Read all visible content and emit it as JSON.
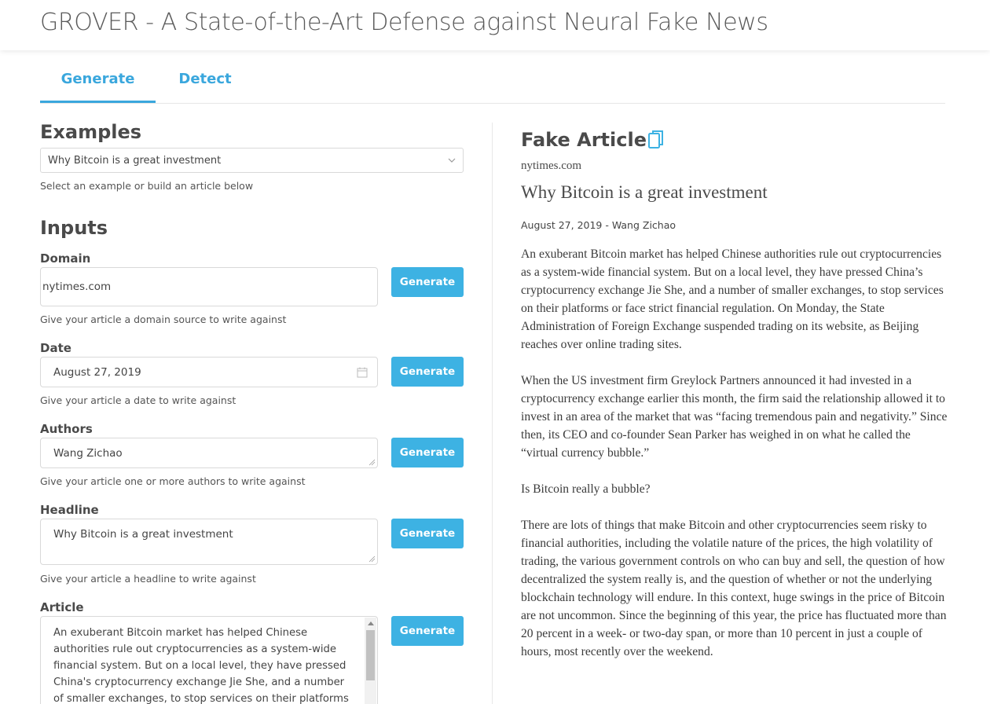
{
  "app": {
    "title": "GROVER - A State-of-the-Art Defense against Neural Fake News"
  },
  "tabs": [
    {
      "label": "Generate",
      "active": true
    },
    {
      "label": "Detect",
      "active": false
    }
  ],
  "examples": {
    "heading": "Examples",
    "selected": "Why Bitcoin is a great investment",
    "hint": "Select an example or build an article below"
  },
  "inputs": {
    "heading": "Inputs",
    "generate_label": "Generate",
    "domain": {
      "label": "Domain",
      "value": "nytimes.com",
      "hint": "Give your article a domain source to write against"
    },
    "date": {
      "label": "Date",
      "value": "August 27, 2019",
      "hint": "Give your article a date to write against"
    },
    "authors": {
      "label": "Authors",
      "value": "Wang Zichao",
      "hint": "Give your article one or more authors to write against"
    },
    "headline": {
      "label": "Headline",
      "value": "Why Bitcoin is a great investment",
      "hint": "Give your article a headline to write against"
    },
    "article": {
      "label": "Article",
      "value": "An exuberant Bitcoin market has helped Chinese authorities rule out cryptocurrencies as a system-wide financial system. But on a local level, they have pressed China's cryptocurrency exchange Jie She, and a number of smaller exchanges, to stop services on their platforms or face strict financial regulation."
    }
  },
  "output": {
    "heading": "Fake Article",
    "domain": "nytimes.com",
    "headline": "Why Bitcoin is a great investment",
    "meta": "August 27, 2019 - Wang Zichao",
    "paragraphs": [
      "An exuberant Bitcoin market has helped Chinese authorities rule out cryptocurrencies as a system-wide financial system. But on a local level, they have pressed China’s cryptocurrency exchange Jie She, and a number of smaller exchanges, to stop services on their platforms or face strict financial regulation. On Monday, the State Administration of Foreign Exchange suspended trading on its website, as Beijing reaches over online trading sites.",
      "When the US investment firm Greylock Partners announced it had invested in a cryptocurrency exchange earlier this month, the firm said the relationship allowed it to invest in an area of the market that was “facing tremendous pain and negativity.” Since then, its CEO and co-founder Sean Parker has weighed in on what he called the “virtual currency bubble.”",
      "Is Bitcoin really a bubble?",
      "There are lots of things that make Bitcoin and other cryptocurrencies seem risky to financial authorities, including the volatile nature of the prices, the high volatility of trading, the various government controls on who can buy and sell, the question of how decentralized the system really is, and the question of whether or not the underlying blockchain technology will endure. In this context, huge swings in the price of Bitcoin are not uncommon. Since the beginning of this year, the price has fluctuated more than 20 percent in a week- or two-day span, or more than 10 percent in just a couple of hours, most recently over the weekend."
    ]
  },
  "colors": {
    "accent": "#3db2e3",
    "text": "#4a4a4a"
  },
  "icons": {
    "copy": "copy-icon",
    "calendar": "calendar-icon",
    "dropdown": "chevron-down-icon"
  }
}
